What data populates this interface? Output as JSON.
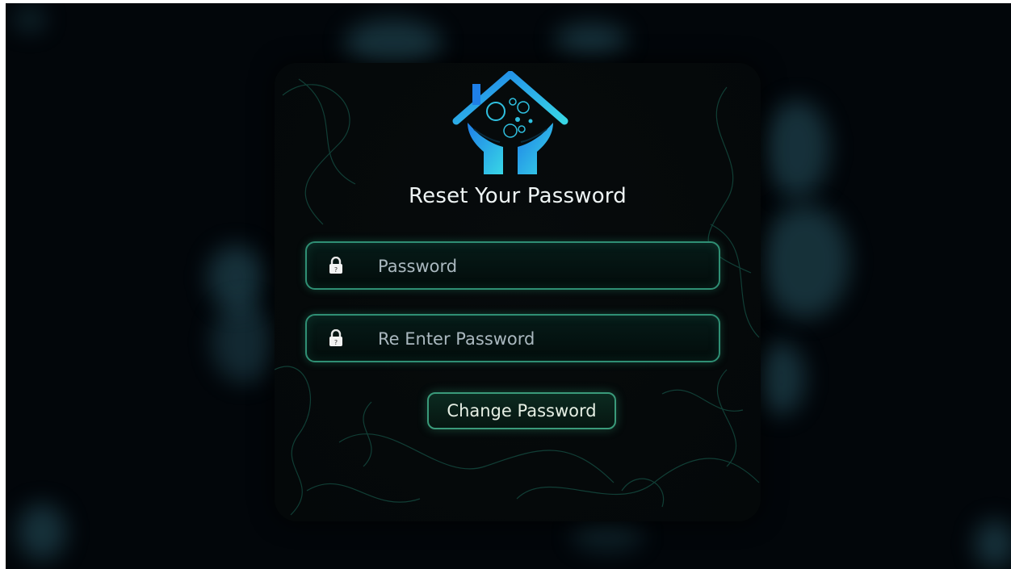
{
  "page": {
    "title": "Reset Your Password"
  },
  "form": {
    "password": {
      "placeholder": "Password",
      "value": ""
    },
    "reenter_password": {
      "placeholder": "Re Enter Password",
      "value": ""
    },
    "submit_label": "Change Password"
  },
  "icons": {
    "logo": "house-hands-logo-icon",
    "field_icon": "lock-icon"
  },
  "colors": {
    "background": "#02060a",
    "card": "#05090a",
    "accent_border": "#2f8f74",
    "logo_blue": "#1e9be8",
    "logo_cyan": "#38d6e6",
    "title_text": "#eef4f4",
    "placeholder_text": "#aab8bf"
  }
}
